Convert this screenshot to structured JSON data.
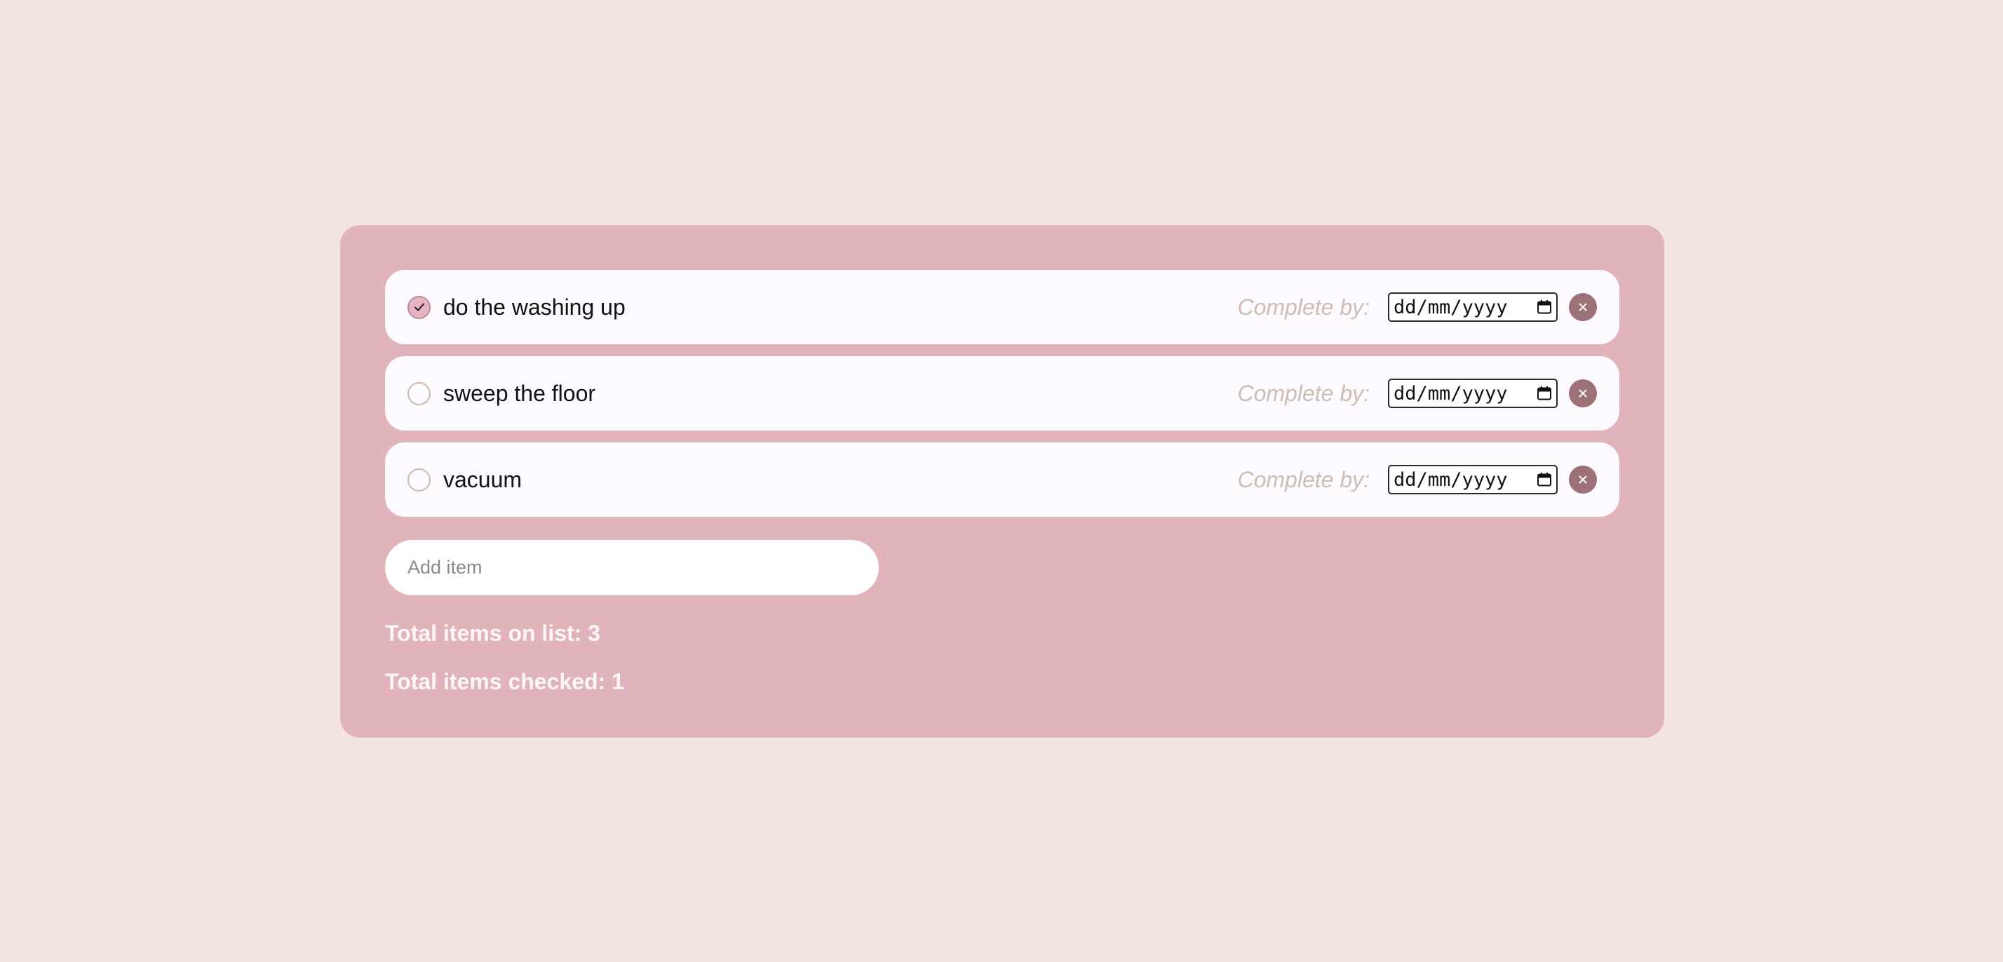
{
  "todo": {
    "complete_by_label": "Complete by:",
    "date_placeholder": "dd/mm/yyyy",
    "remove_symbol": "×",
    "items": [
      {
        "label": "do the washing up",
        "checked": true
      },
      {
        "label": "sweep the floor",
        "checked": false
      },
      {
        "label": "vacuum",
        "checked": false
      }
    ],
    "add_item_placeholder": "Add item",
    "total_items_text": "Total items on list: 3",
    "total_checked_text": "Total items checked: 1"
  },
  "icons": {
    "checkbox_checked": "checkmark-icon",
    "date_picker": "calendar-icon",
    "remove": "close-icon"
  },
  "colors": {
    "page_background": "#f3e4e2",
    "card_background": "#e0b4ba",
    "row_background": "#fcf9ff",
    "checked_fill": "#e8b4c4",
    "remove_button": "#9d7178",
    "complete_by_text": "#cdbdb2"
  }
}
